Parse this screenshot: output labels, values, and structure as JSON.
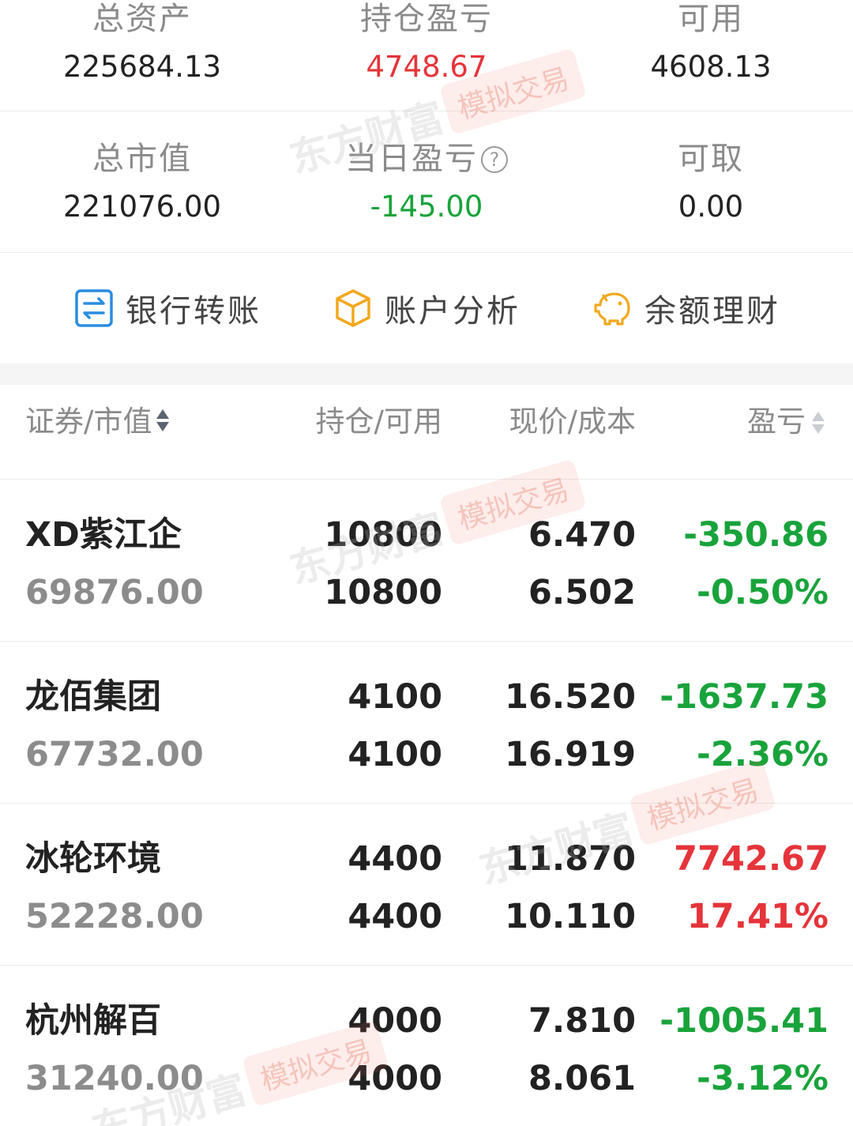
{
  "summary": {
    "total_assets": {
      "label": "总资产",
      "value": "225684.13"
    },
    "position_pnl": {
      "label": "持仓盈亏",
      "value": "4748.67",
      "color": "#e5343a"
    },
    "available": {
      "label": "可用",
      "value": "4608.13"
    },
    "market_value": {
      "label": "总市值",
      "value": "221076.00"
    },
    "daily_pnl": {
      "label": "当日盈亏",
      "value": "-145.00",
      "color": "#19a33b",
      "icon": "help-icon"
    },
    "withdrawable": {
      "label": "可取",
      "value": "0.00"
    }
  },
  "actions": [
    {
      "label": "银行转账",
      "icon": "bank-transfer-icon",
      "color": "#2a8de0"
    },
    {
      "label": "账户分析",
      "icon": "cube-icon",
      "color": "#f2a81d"
    },
    {
      "label": "余额理财",
      "icon": "piggy-bank-icon",
      "color": "#f2a81d"
    }
  ],
  "table": {
    "headers": {
      "security": "证券/市值",
      "position": "持仓/可用",
      "price": "现价/成本",
      "pnl": "盈亏"
    },
    "rows": [
      {
        "name": "XD紫江企",
        "market_value": "69876.00",
        "holding": "10800",
        "available": "10800",
        "price": "6.470",
        "cost": "6.502",
        "pnl": "-350.86",
        "pnl_pct": "-0.50%",
        "trend": "down"
      },
      {
        "name": "龙佰集团",
        "market_value": "67732.00",
        "holding": "4100",
        "available": "4100",
        "price": "16.520",
        "cost": "16.919",
        "pnl": "-1637.73",
        "pnl_pct": "-2.36%",
        "trend": "down"
      },
      {
        "name": "冰轮环境",
        "market_value": "52228.00",
        "holding": "4400",
        "available": "4400",
        "price": "11.870",
        "cost": "10.110",
        "pnl": "7742.67",
        "pnl_pct": "17.41%",
        "trend": "up"
      },
      {
        "name": "杭州解百",
        "market_value": "31240.00",
        "holding": "4000",
        "available": "4000",
        "price": "7.810",
        "cost": "8.061",
        "pnl": "-1005.41",
        "pnl_pct": "-3.12%",
        "trend": "down"
      }
    ]
  },
  "watermark": {
    "brand": "东方财富",
    "tag": "模拟交易"
  },
  "colors": {
    "up": "#e5343a",
    "down": "#19a33b"
  }
}
